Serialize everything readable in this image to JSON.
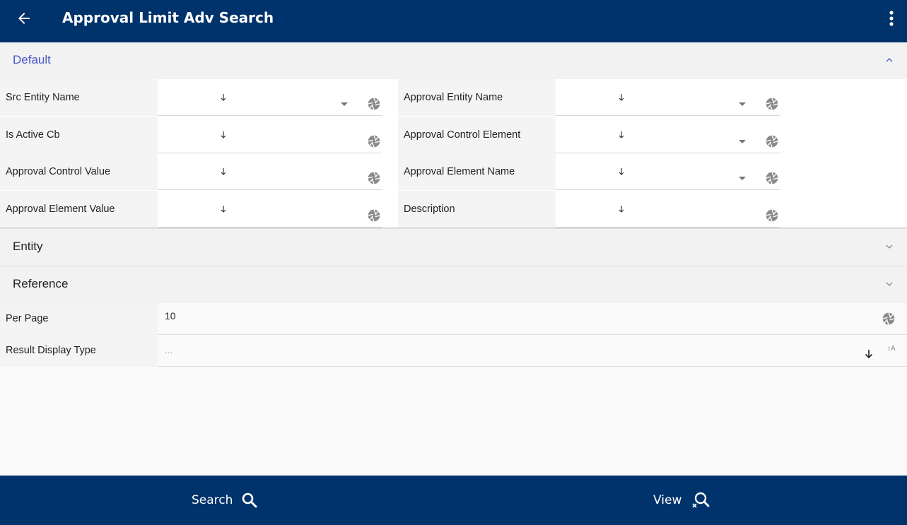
{
  "header": {
    "title": "Approval Limit  Adv Search"
  },
  "sections": {
    "default": "Default",
    "entity": "Entity",
    "reference": "Reference"
  },
  "fields_left": [
    {
      "label": "Src Entity Name",
      "dropdown": true
    },
    {
      "label": "Is Active Cb",
      "dropdown": false
    },
    {
      "label": "Approval Control Value",
      "dropdown": false
    },
    {
      "label": "Approval Element Value",
      "dropdown": false
    }
  ],
  "fields_right": [
    {
      "label": "Approval Entity Name",
      "dropdown": true
    },
    {
      "label": "Approval Control Element",
      "dropdown": true
    },
    {
      "label": "Approval Element Name",
      "dropdown": true
    },
    {
      "label": "Description",
      "dropdown": false
    }
  ],
  "per_page": {
    "label": "Per Page",
    "value": "10"
  },
  "result_display": {
    "label": "Result Display Type",
    "value": "..."
  },
  "footer": {
    "search_label": "Search",
    "view_label": "View"
  },
  "colors": {
    "primary": "#00336b",
    "accent": "#4a57c9"
  }
}
